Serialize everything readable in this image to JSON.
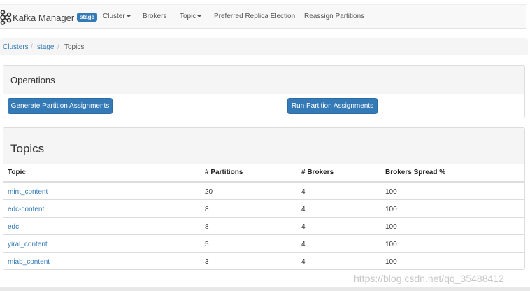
{
  "brand": {
    "name": "Kafka Manager",
    "cluster_badge": "stage"
  },
  "nav": {
    "items": [
      {
        "label": "Cluster",
        "dropdown": true
      },
      {
        "label": "Brokers",
        "dropdown": false
      },
      {
        "label": "Topic",
        "dropdown": true
      },
      {
        "label": "Preferred Replica Election",
        "dropdown": false
      },
      {
        "label": "Reassign Partitions",
        "dropdown": false
      }
    ]
  },
  "breadcrumb": {
    "items": [
      "Clusters",
      "stage",
      "Topics"
    ],
    "separator": "/"
  },
  "operations": {
    "title": "Operations",
    "buttons": [
      "Generate Partition Assignments",
      "Run Partition Assignments"
    ]
  },
  "topics": {
    "title": "Topics",
    "columns": [
      "Topic",
      "# Partitions",
      "# Brokers",
      "Brokers Spread %"
    ],
    "rows": [
      {
        "topic": "mint_content",
        "partitions": "20",
        "brokers": "4",
        "spread": "100"
      },
      {
        "topic": "edc-content",
        "partitions": "8",
        "brokers": "4",
        "spread": "100"
      },
      {
        "topic": "edc",
        "partitions": "8",
        "brokers": "4",
        "spread": "100"
      },
      {
        "topic": "yiral_content",
        "partitions": "5",
        "brokers": "4",
        "spread": "100"
      },
      {
        "topic": "miab_content",
        "partitions": "3",
        "brokers": "4",
        "spread": "100"
      }
    ]
  },
  "watermark": "https://blog.csdn.net/qq_35488412",
  "colors": {
    "primary": "#337ab7",
    "link": "#337ab7",
    "navbar_bg": "#f8f8f8",
    "panel_heading_bg": "#f5f5f5"
  },
  "icons": {
    "brand": "kafka-logo-icon",
    "dropdown": "caret-down-icon"
  }
}
